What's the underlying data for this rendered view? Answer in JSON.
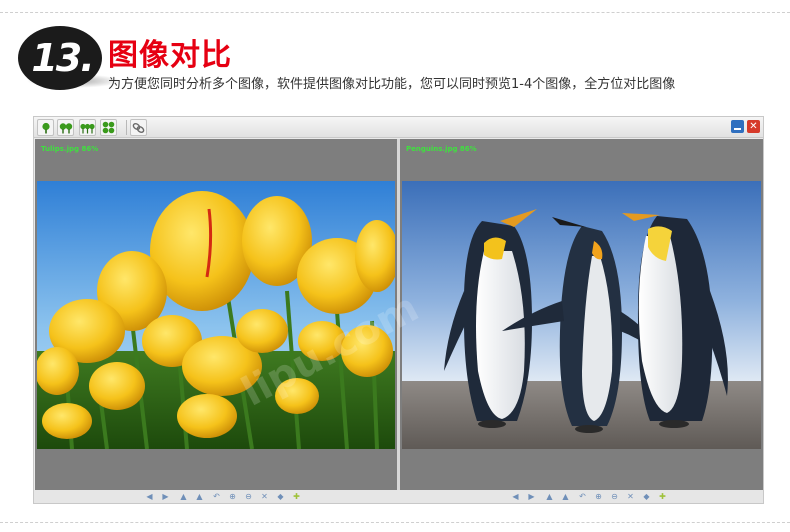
{
  "header": {
    "step_number": "13.",
    "title": "图像对比",
    "subtitle": "为方便您同时分析多个图像，软件提供图像对比功能，您可以同时预览1-4个图像，全方位对比图像"
  },
  "app": {
    "toolbar": {
      "buttons": [
        {
          "name": "single-view",
          "icon": "one-tree-icon"
        },
        {
          "name": "dual-view",
          "icon": "two-trees-icon"
        },
        {
          "name": "triple-view",
          "icon": "three-trees-icon"
        },
        {
          "name": "quad-view",
          "icon": "four-trees-icon"
        },
        {
          "name": "link-view",
          "icon": "chain-link-icon"
        }
      ],
      "window_buttons": [
        {
          "name": "minimize",
          "icon": "minimize-icon"
        },
        {
          "name": "close",
          "icon": "close-icon",
          "glyph": "✕"
        }
      ]
    },
    "panes": [
      {
        "label": "Tulips.jpg  86%",
        "image": "tulips-photo"
      },
      {
        "label": "Penguins.jpg  86%",
        "image": "penguins-photo"
      }
    ],
    "controls": {
      "glyphs": [
        "◀",
        "▶",
        "▲",
        "▲",
        "↶",
        "⊕",
        "⊖",
        "✕",
        "◆",
        "✚"
      ]
    }
  },
  "colors": {
    "accent_red": "#e60012",
    "badge_black": "#1b1b1b",
    "pane_gray": "#7e7e7e",
    "label_green": "#3fe03f",
    "toolbar_icon_green": "#3a9a1c"
  }
}
